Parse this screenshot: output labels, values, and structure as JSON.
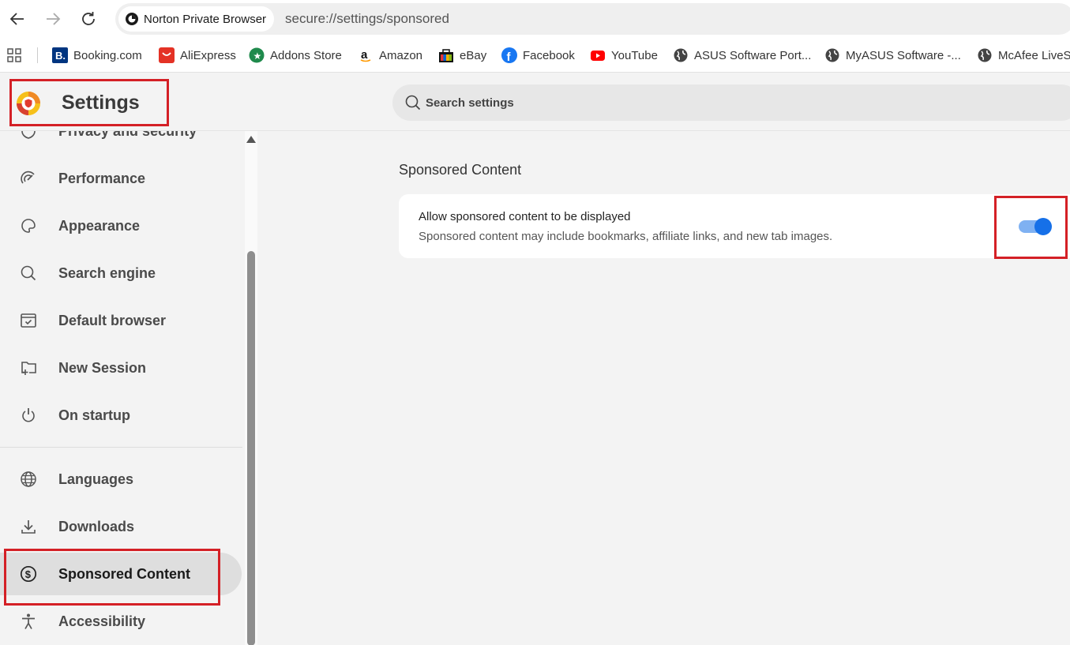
{
  "browser": {
    "site_name": "Norton Private Browser",
    "url": "secure://settings/sponsored"
  },
  "bookmarks": [
    {
      "label": "Booking.com",
      "icon": "booking-icon"
    },
    {
      "label": "AliExpress",
      "icon": "aliexpress-icon"
    },
    {
      "label": "Addons Store",
      "icon": "addons-store-icon"
    },
    {
      "label": "Amazon",
      "icon": "amazon-icon"
    },
    {
      "label": "eBay",
      "icon": "ebay-icon"
    },
    {
      "label": "Facebook",
      "icon": "facebook-icon"
    },
    {
      "label": "YouTube",
      "icon": "youtube-icon"
    },
    {
      "label": "ASUS Software Port...",
      "icon": "globe-icon"
    },
    {
      "label": "MyASUS Software -...",
      "icon": "globe-icon"
    },
    {
      "label": "McAfee LiveSa",
      "icon": "globe-icon"
    }
  ],
  "header": {
    "title": "Settings",
    "search_placeholder": "Search settings"
  },
  "sidebar": {
    "items": [
      {
        "label": "Privacy and security",
        "icon": "shield-icon"
      },
      {
        "label": "Performance",
        "icon": "gauge-icon"
      },
      {
        "label": "Appearance",
        "icon": "palette-icon"
      },
      {
        "label": "Search engine",
        "icon": "search-icon"
      },
      {
        "label": "Default browser",
        "icon": "browser-window-icon"
      },
      {
        "label": "New Session",
        "icon": "folder-plus-icon"
      },
      {
        "label": "On startup",
        "icon": "power-icon"
      },
      {
        "label": "Languages",
        "icon": "globe-icon"
      },
      {
        "label": "Downloads",
        "icon": "download-icon"
      },
      {
        "label": "Sponsored Content",
        "icon": "dollar-circle-icon",
        "active": true
      },
      {
        "label": "Accessibility",
        "icon": "accessibility-icon"
      }
    ]
  },
  "main": {
    "section_title": "Sponsored Content",
    "setting": {
      "title": "Allow sponsored content to be displayed",
      "description": "Sponsored content may include bookmarks, affiliate links, and new tab images.",
      "enabled": true
    }
  },
  "colors": {
    "accent": "#1670e8",
    "highlight_box": "#d42026"
  }
}
